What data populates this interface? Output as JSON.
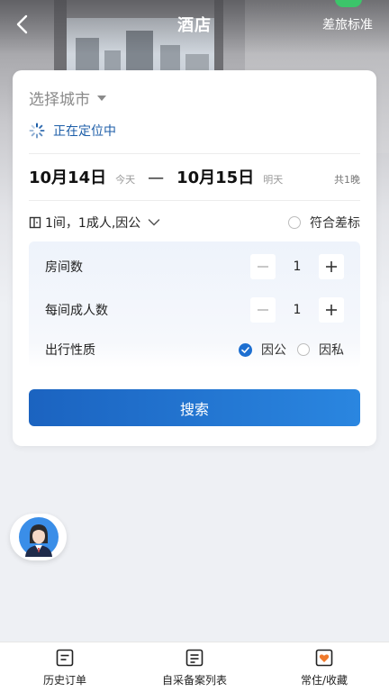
{
  "header": {
    "title": "酒店",
    "policy_link": "差旅标准"
  },
  "location": {
    "city_placeholder": "选择城市",
    "status": "正在定位中"
  },
  "dates": {
    "check_in": "10月14日",
    "check_in_tag": "今天",
    "separator": "—",
    "check_out": "10月15日",
    "check_out_tag": "明天",
    "nights": "共1晚"
  },
  "summary": {
    "text": "1间，1成人,因公",
    "comply_label": "符合差标"
  },
  "options": {
    "rooms_label": "房间数",
    "rooms_value": "1",
    "adults_label": "每间成人数",
    "adults_value": "1",
    "purpose_label": "出行性质",
    "purpose_business": "因公",
    "purpose_private": "因私",
    "purpose_selected": "因公"
  },
  "search_button": "搜索",
  "tabs": [
    {
      "label": "历史订单",
      "icon": "order-history-icon"
    },
    {
      "label": "自采备案列表",
      "icon": "record-list-icon"
    },
    {
      "label": "常住/收藏",
      "icon": "favorite-icon"
    }
  ],
  "colors": {
    "accent": "#1d6fd1",
    "favorite": "#f07a2c"
  }
}
